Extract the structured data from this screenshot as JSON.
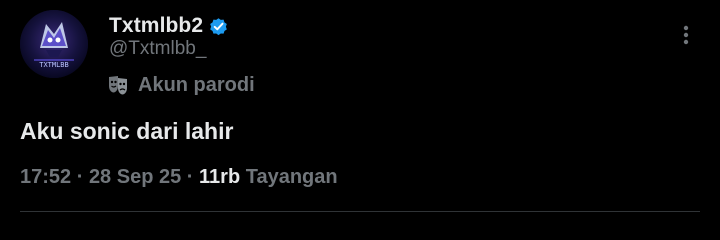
{
  "author": {
    "display_name": "Txtmlbb2",
    "handle": "@Txtmlbb_",
    "verified": true,
    "avatar_text": "TXTMLBB",
    "parody_label": "Akun parodi"
  },
  "tweet": {
    "text": "Aku sonic dari lahir",
    "time": "17:52",
    "separator": " · ",
    "date": "28 Sep 25",
    "views_count": "11rb",
    "views_label": "Tayangan"
  },
  "colors": {
    "background": "#000000",
    "primary_text": "#e7e9ea",
    "secondary_text": "#71767b",
    "verified_blue": "#1d9bf0",
    "divider": "#2f3336"
  },
  "icons": {
    "verified": "verified-badge-icon",
    "parody": "theater-mask-icon",
    "more": "more-vertical-icon"
  }
}
